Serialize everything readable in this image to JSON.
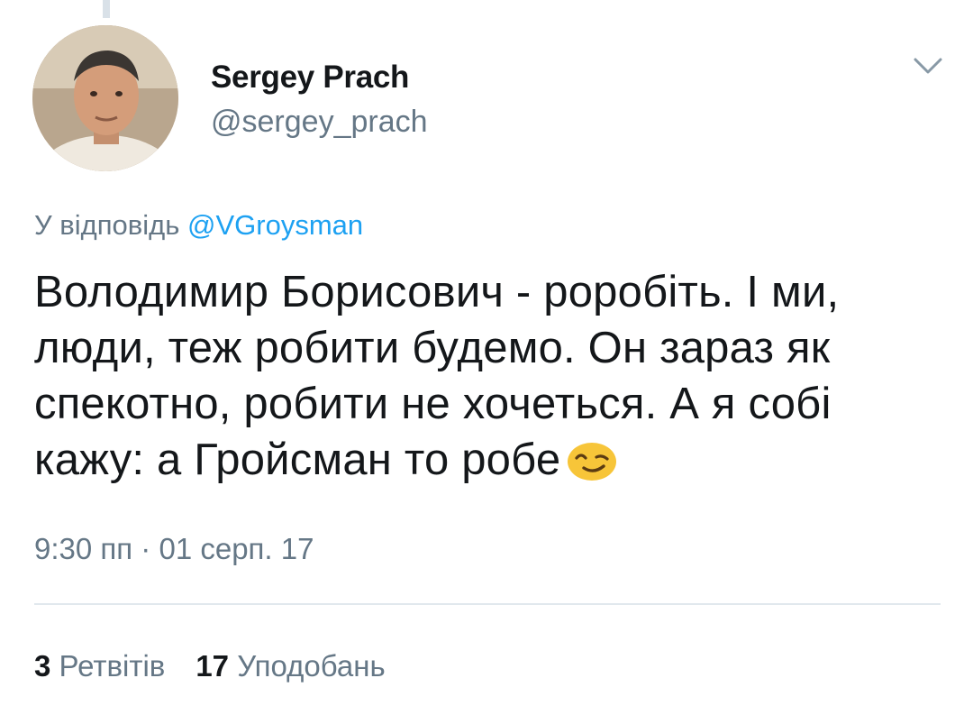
{
  "tweet": {
    "author_name": "Sergey Prach",
    "author_handle": "@sergey_prach",
    "reply_prefix": "У відповідь ",
    "reply_to": "@VGroysman",
    "text": "Володимир Борисович - роробіть. І ми, люди, теж робити будемо. Он зараз як спекотно, робити не хочеться. А я собі кажу: а Гройсман то робе",
    "emoji": "winking-face",
    "timestamp": "9:30 пп · 01 серп. 17"
  },
  "stats": {
    "retweets_count": "3",
    "retweets_label": "Ретвітів",
    "likes_count": "17",
    "likes_label": "Уподобань"
  },
  "colors": {
    "text": "#14171a",
    "secondary": "#657786",
    "link": "#1da1f2",
    "divider": "#e1e8ed"
  }
}
